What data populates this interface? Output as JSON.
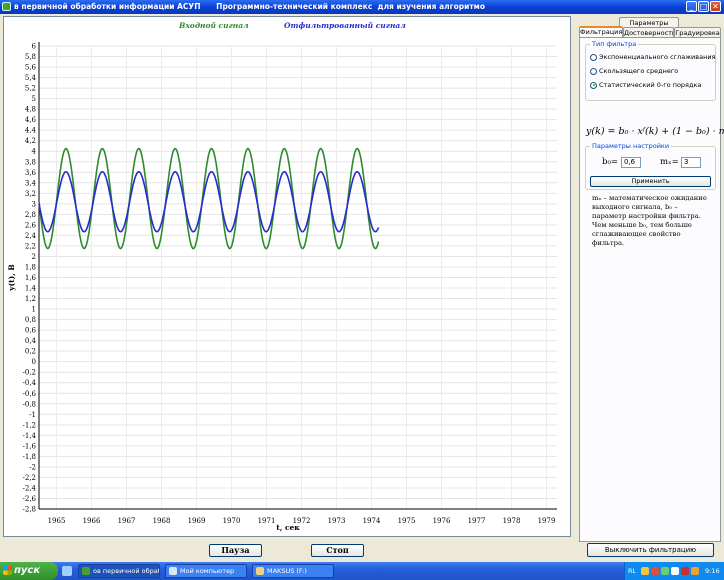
{
  "window": {
    "title": "в первичной обработки информации АСУП      Программно-технический комплекс  для изучения алгоритмо"
  },
  "chart": {
    "legend_input": "Входной сигнал",
    "legend_output": "Отфильтрованный сигнал"
  },
  "buttons": {
    "pause": "Пауза",
    "stop": "Стоп",
    "apply": "Применить",
    "disable_filter": "Выключить фильтрацию"
  },
  "right_panel": {
    "tabs_row_top": [
      "Параметры"
    ],
    "tabs_row_bottom": [
      "Фильтрация",
      "Достоверность",
      "Градуировка"
    ],
    "active_tab": "Фильтрация",
    "filter_type": {
      "title": "Тип фильтра",
      "options": [
        "Экспоненциального сглаживания",
        "Скользящего среднего",
        "Статистический 0-го порядка"
      ],
      "selected": "Статистический 0-го порядка"
    },
    "formula": "y(k) = b₀ · xᶠ(k) + (1 − b₀) · mₓ",
    "params": {
      "title": "Параметры настройки",
      "b0_label": "b₀=",
      "b0_value": "0,6",
      "mx_label": "mₓ=",
      "mx_value": "3"
    },
    "description": "mₓ – математическое ожидание выходного сигнала, b₀ – параметр настройки фильтра. Чем меньше b₀, тем больше сглаживающее свойство фильтра."
  },
  "taskbar": {
    "start_label": "пуск",
    "tasks": [
      "ов первичной обраб...",
      "Мой компьютер",
      "MAKSUS (F:)"
    ],
    "lang": "RL",
    "clock": "9:16"
  },
  "chart_data": {
    "type": "line",
    "xlabel": "t, сек",
    "ylabel": "y(t), В",
    "ylim": [
      -2.8,
      6
    ],
    "xlim": [
      1964.5,
      1979.3
    ],
    "y_ticks": [
      6,
      5.8,
      5.6,
      5.4,
      5.2,
      5,
      4.8,
      4.6,
      4.4,
      4.2,
      4,
      3.8,
      3.6,
      3.4,
      3.2,
      3,
      2.8,
      2.6,
      2.4,
      2.2,
      2,
      1.8,
      1.6,
      1.4,
      1.2,
      1,
      0.8,
      0.6,
      0.4,
      0.2,
      0,
      -0.2,
      -0.4,
      -0.6,
      -0.8,
      -1,
      -1.2,
      -1.4,
      -1.6,
      -1.8,
      -2,
      -2.2,
      -2.4,
      -2.6,
      -2.8
    ],
    "x_ticks": [
      1965,
      1966,
      1967,
      1968,
      1969,
      1970,
      1971,
      1972,
      1973,
      1974,
      1975,
      1976,
      1977,
      1978,
      1979
    ],
    "grid": true,
    "series": [
      {
        "name": "Входной сигнал",
        "color": "#2e8b2e",
        "x_start": 1964.5,
        "x_end": 1974.2,
        "mean": 3.1,
        "amplitude": 0.95,
        "period": 1.04,
        "phase_x": 1964.75
      },
      {
        "name": "Отфильтрованный сигнал",
        "color": "#2a2ad0",
        "x_start": 1964.5,
        "x_end": 1974.2,
        "mean": 3.04,
        "amplitude": 0.57,
        "period": 1.04,
        "phase_x": 1964.75
      }
    ]
  }
}
